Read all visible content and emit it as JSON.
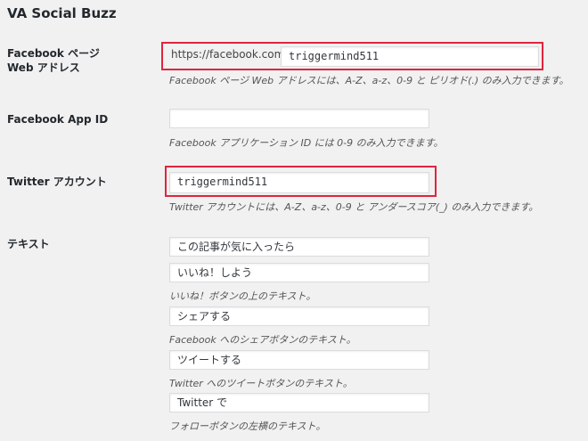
{
  "section_title": "VA Social Buzz",
  "facebook_page": {
    "label_line1": "Facebook ページ",
    "label_line2": "Web アドレス",
    "prefix": "https://facebook.com/",
    "value": "triggermind511",
    "description": "Facebook ページ Web アドレスには、A-Z、a-z、0-9 と ピリオド(.) のみ入力できます。"
  },
  "facebook_app_id": {
    "label": "Facebook App ID",
    "value": "",
    "description": "Facebook アプリケーション ID には 0-9 のみ入力できます。"
  },
  "twitter_account": {
    "label": "Twitter アカウント",
    "value": "triggermind511",
    "description": "Twitter アカウントには、A-Z、a-z、0-9 と アンダースコア(_) のみ入力できます。"
  },
  "text": {
    "label": "テキスト",
    "fields": [
      {
        "value": "この記事が気に入ったら",
        "description": ""
      },
      {
        "value": "いいね！しよう",
        "description": "いいね！ボタンの上のテキスト。"
      },
      {
        "value": "シェアする",
        "description": "Facebook へのシェアボタンのテキスト。"
      },
      {
        "value": "ツイートする",
        "description": "Twitter へのツイートボタンのテキスト。"
      },
      {
        "value": "Twitter で",
        "description": "フォローボタンの左横のテキスト。"
      }
    ]
  },
  "highlight_color": "#e0243f"
}
